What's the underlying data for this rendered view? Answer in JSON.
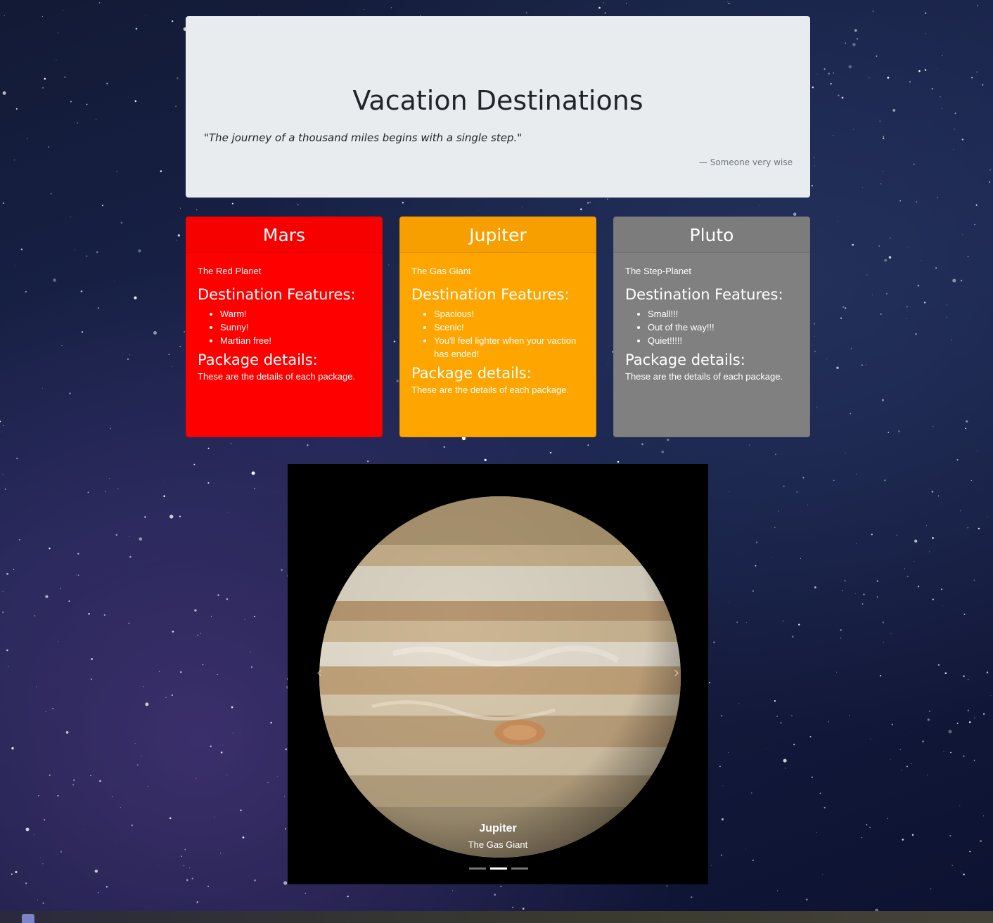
{
  "jumbotron": {
    "title": "Vacation Destinations",
    "quote": "\"The journey of a thousand miles begins with a single step.\"",
    "cite": "— Someone very wise"
  },
  "cards": [
    {
      "name": "Mars",
      "color": "#ff0000",
      "subtitle": "The Red Planet",
      "features_heading": "Destination Features:",
      "features": [
        "Warm!",
        "Sunny!",
        "Martian free!"
      ],
      "package_heading": "Package details:",
      "package_text": "These are the details of each package."
    },
    {
      "name": "Jupiter",
      "color": "#ffa500",
      "subtitle": "The Gas Giant",
      "features_heading": "Destination Features:",
      "features": [
        "Spacious!",
        "Scenic!",
        "You'll feel lighter when your vaction has ended!"
      ],
      "package_heading": "Package details:",
      "package_text": "These are the details of each package."
    },
    {
      "name": "Pluto",
      "color": "#808080",
      "subtitle": "The Step-Planet",
      "features_heading": "Destination Features:",
      "features": [
        "Small!!!",
        "Out of the way!!!",
        "Quiet!!!!!"
      ],
      "package_heading": "Package details:",
      "package_text": "These are the details of each package."
    }
  ],
  "carousel": {
    "prev_icon": "chevron-left-icon",
    "next_icon": "chevron-right-icon",
    "caption_title": "Jupiter",
    "caption_subtitle": "The Gas Giant",
    "slide_count": 3,
    "active_slide": 2
  }
}
